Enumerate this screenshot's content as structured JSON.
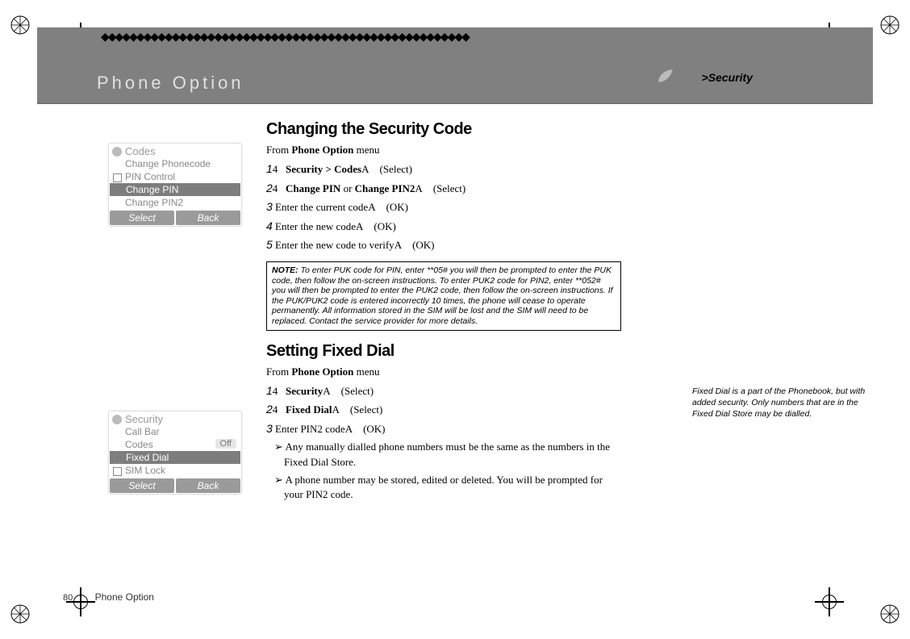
{
  "header": {
    "chapter": "Phone Option",
    "section": ">Security",
    "diamonds": "◆◆◆◆◆◆◆◆◆◆◆◆◆◆◆◆◆◆◆◆◆◆◆◆◆◆◆◆◆◆◆◆◆◆◆◆◆◆◆◆◆◆◆◆◆◆◆◆◆◆◆◆"
  },
  "section1": {
    "title": "Changing the Security Code",
    "intro_prefix": "From ",
    "intro_bold": "Phone Option",
    "intro_suffix": " menu",
    "steps": [
      {
        "num": "1",
        "nav": "4",
        "bold": "Security > Codes",
        "tail": "A",
        "paren": "(Select)"
      },
      {
        "num": "2",
        "nav": "4",
        "bold": "Change PIN",
        "mid": " or ",
        "bold2": "Change PIN2",
        "tail": "A",
        "paren": "(Select)"
      },
      {
        "num": "3",
        "text": " Enter the current code",
        "tail": "A",
        "paren": "(OK)"
      },
      {
        "num": "4",
        "text": " Enter the new code",
        "tail": "A",
        "paren": "(OK)"
      },
      {
        "num": "5",
        "text": " Enter the new code to verify",
        "tail": "A",
        "paren": "(OK)"
      }
    ],
    "note_label": "NOTE:",
    "note_body": " To enter PUK code for PIN, enter **05# you will then be prompted to enter the PUK code, then follow the on-screen instructions. To enter PUK2 code for PIN2, enter **052# you will then be prompted to enter the PUK2 code, then follow the on-screen instructions. If the PUK/PUK2 code is entered incorrectly 10 times, the phone will cease to operate permanently. All information stored in the SIM will be lost and the SIM will need to be replaced. Contact the service provider for more details."
  },
  "section2": {
    "title": "Setting Fixed Dial",
    "intro_prefix": "From ",
    "intro_bold": "Phone Option",
    "intro_suffix": " menu",
    "steps": [
      {
        "num": "1",
        "nav": "4",
        "bold": "Security",
        "tail": "A",
        "paren": "(Select)"
      },
      {
        "num": "2",
        "nav": "4",
        "bold": "Fixed Dial",
        "tail": "A",
        "paren": "(Select)"
      },
      {
        "num": "3",
        "text": " Enter PIN2 code",
        "tail": "A",
        "paren": "(OK)"
      }
    ],
    "bullets": [
      "Any manually dialled phone numbers must be the same as the numbers in the Fixed Dial Store.",
      "A phone number may be stored, edited or deleted. You will be prompted for your PIN2 code."
    ]
  },
  "side_note": "Fixed Dial is a part of the Phonebook, but with added security. Only numbers that are in the Fixed Dial Store may be dialled.",
  "phone1": {
    "title": "Codes",
    "rows": [
      {
        "label": "Change Phonecode",
        "box": false
      },
      {
        "label": "PIN Control",
        "box": true
      },
      {
        "label": "Change PIN",
        "hl": true
      },
      {
        "label": "Change PIN2",
        "box": false
      }
    ],
    "left": "Select",
    "right": "Back"
  },
  "phone2": {
    "title": "Security",
    "rows": [
      {
        "label": "Call Bar",
        "box": false
      },
      {
        "label": "Codes",
        "box": false,
        "val": "Off"
      },
      {
        "label": "Fixed Dial",
        "hl": true,
        "box": true
      },
      {
        "label": "SIM Lock",
        "box": true
      }
    ],
    "left": "Select",
    "right": "Back"
  },
  "footer": {
    "page": "80",
    "chapter": "Phone Option"
  }
}
